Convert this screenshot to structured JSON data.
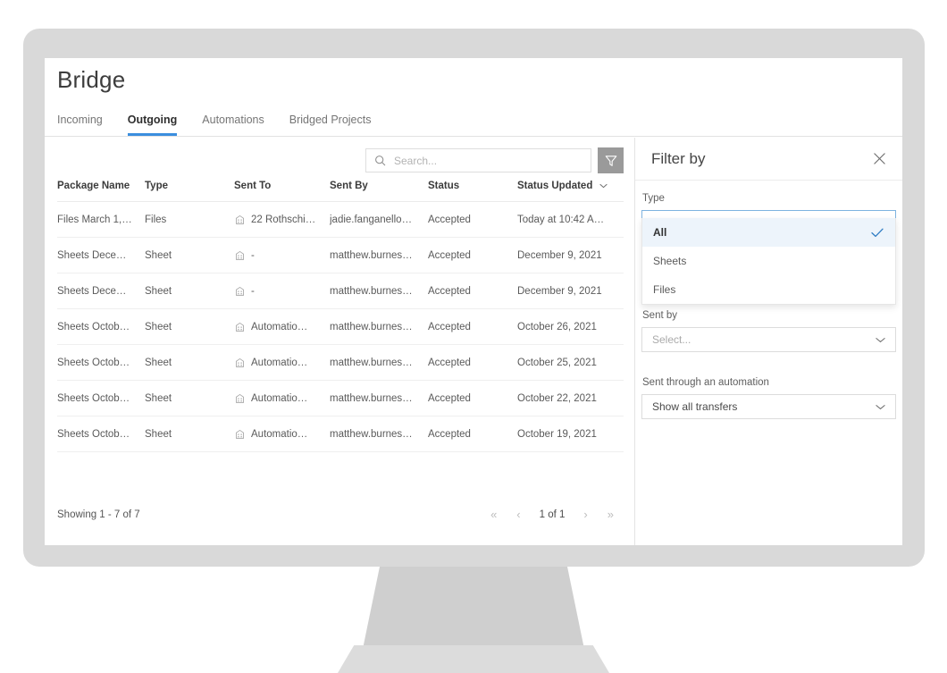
{
  "app": {
    "title": "Bridge"
  },
  "tabs": [
    {
      "label": "Incoming",
      "active": false
    },
    {
      "label": "Outgoing",
      "active": true
    },
    {
      "label": "Automations",
      "active": false
    },
    {
      "label": "Bridged Projects",
      "active": false
    }
  ],
  "search": {
    "value": "",
    "placeholder": "Search...",
    "icon": "search-icon"
  },
  "filter_toggle": {
    "icon": "funnel-icon",
    "active": true
  },
  "table": {
    "columns": [
      {
        "key": "package_name",
        "label": "Package Name",
        "sortable": false
      },
      {
        "key": "type",
        "label": "Type",
        "sortable": false
      },
      {
        "key": "sent_to",
        "label": "Sent To",
        "sortable": false
      },
      {
        "key": "sent_by",
        "label": "Sent By",
        "sortable": false
      },
      {
        "key": "status",
        "label": "Status",
        "sortable": false
      },
      {
        "key": "status_updated",
        "label": "Status Updated",
        "sortable": true,
        "sort_icon": "chevron-down-icon"
      }
    ],
    "rows": [
      {
        "package_name": "Files March 1,…",
        "type": "Files",
        "sent_to": "22 Rothschi…",
        "sent_to_icon": "company-icon",
        "sent_by": "jadie.fanganello…",
        "status": "Accepted",
        "status_updated": "Today at 10:42 A…"
      },
      {
        "package_name": "Sheets Dece…",
        "type": "Sheet",
        "sent_to": "-",
        "sent_to_icon": "company-icon",
        "sent_by": "matthew.burnes…",
        "status": "Accepted",
        "status_updated": "December 9, 2021"
      },
      {
        "package_name": "Sheets Dece…",
        "type": "Sheet",
        "sent_to": "-",
        "sent_to_icon": "company-icon",
        "sent_by": "matthew.burnes…",
        "status": "Accepted",
        "status_updated": "December 9, 2021"
      },
      {
        "package_name": "Sheets Octob…",
        "type": "Sheet",
        "sent_to": "Automatio…",
        "sent_to_icon": "company-icon",
        "sent_by": "matthew.burnes…",
        "status": "Accepted",
        "status_updated": "October 26, 2021"
      },
      {
        "package_name": "Sheets Octob…",
        "type": "Sheet",
        "sent_to": "Automatio…",
        "sent_to_icon": "company-icon",
        "sent_by": "matthew.burnes…",
        "status": "Accepted",
        "status_updated": "October 25, 2021"
      },
      {
        "package_name": "Sheets Octob…",
        "type": "Sheet",
        "sent_to": "Automatio…",
        "sent_to_icon": "company-icon",
        "sent_by": "matthew.burnes…",
        "status": "Accepted",
        "status_updated": "October 22, 2021"
      },
      {
        "package_name": "Sheets Octob…",
        "type": "Sheet",
        "sent_to": "Automatio…",
        "sent_to_icon": "company-icon",
        "sent_by": "matthew.burnes…",
        "status": "Accepted",
        "status_updated": "October 19, 2021"
      }
    ]
  },
  "footer": {
    "showing": "Showing 1 - 7 of 7",
    "page_indicator": "1 of 1",
    "first_label": "«",
    "prev_label": "‹",
    "next_label": "›",
    "last_label": "»"
  },
  "filter_panel": {
    "title": "Filter by",
    "close_icon": "close-icon",
    "type": {
      "label": "Type",
      "value": "All",
      "expanded": true,
      "chevron_icon": "chevron-up-icon",
      "options": [
        {
          "label": "All",
          "selected": true,
          "check_icon": "check-icon"
        },
        {
          "label": "Sheets",
          "selected": false
        },
        {
          "label": "Files",
          "selected": false
        }
      ]
    },
    "sent_by": {
      "label": "Sent by",
      "placeholder": "Select...",
      "value": "",
      "chevron_icon": "chevron-down-icon"
    },
    "automation": {
      "label": "Sent through an automation",
      "value": "Show all transfers",
      "chevron_icon": "chevron-down-icon"
    }
  },
  "colors": {
    "accent_blue": "#3b8ede",
    "selected_row_bg": "#edf4fb",
    "bezel": "#d9d9d9",
    "filter_button_bg": "#9a9a9a"
  }
}
